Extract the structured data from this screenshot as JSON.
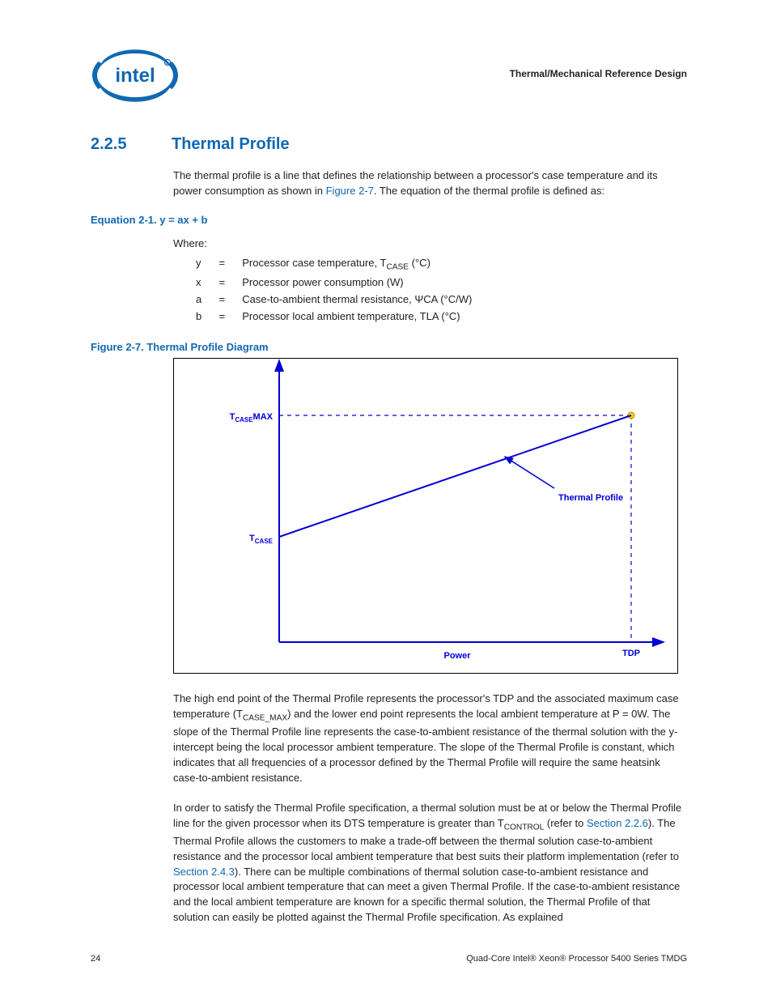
{
  "header": {
    "doc_section": "Thermal/Mechanical Reference Design"
  },
  "section": {
    "number": "2.2.5",
    "title": "Thermal Profile"
  },
  "intro_pre": "The thermal profile is a line that defines the relationship between a processor's case temperature and its power consumption as shown in ",
  "intro_link": "Figure 2-7",
  "intro_post": ". The equation of the thermal profile is defined as:",
  "equation": {
    "label": "Equation 2-1. y = ax + b"
  },
  "where_label": "Where:",
  "vars": {
    "y": {
      "sym": "y",
      "eq": "=",
      "desc_pre": "Processor case temperature, T",
      "desc_sub": "CASE",
      "desc_post": " (°C)"
    },
    "x": {
      "sym": "x",
      "eq": "=",
      "desc": "Processor power consumption (W)"
    },
    "a": {
      "sym": "a",
      "eq": "=",
      "desc": "Case-to-ambient thermal resistance, ΨCA (°C/W)"
    },
    "b": {
      "sym": "b",
      "eq": "=",
      "desc": "Processor local ambient temperature, TLA (°C)"
    }
  },
  "figure": {
    "label": "Figure 2-7.  Thermal Profile Diagram",
    "y_max_label_pre": "T",
    "y_max_label_sub": "CASE",
    "y_max_label_post": "MAX",
    "y_low_label_pre": "T",
    "y_low_label_sub": "CASE",
    "line_label": "Thermal Profile",
    "x_tdp_label": "TDP",
    "x_axis_label": "Power"
  },
  "para2_a": "The high end point of the Thermal Profile represents the processor's TDP and the associated maximum case temperature (T",
  "para2_sub": "CASE_MAX",
  "para2_b": ") and the lower end point represents the local ambient temperature at P = 0W. The slope of the Thermal Profile line represents the case-to-ambient resistance of the thermal solution with the y-intercept being the local processor ambient temperature. The slope of the Thermal Profile is constant, which indicates that all frequencies of a processor defined by the Thermal Profile will require the same heatsink case-to-ambient resistance.",
  "para3_a": "In order to satisfy the Thermal Profile specification, a thermal solution must be at or below the Thermal Profile line for the given processor when its DTS temperature is greater than T",
  "para3_sub": "CONTROL",
  "para3_b": " (refer to ",
  "para3_link1": "Section 2.2.6",
  "para3_c": "). The Thermal Profile allows the customers to make a trade-off between the thermal solution case-to-ambient resistance and the processor local ambient temperature that best suits their platform implementation (refer to ",
  "para3_link2": "Section 2.4.3",
  "para3_d": "). There can be multiple combinations of thermal solution case-to-ambient resistance and processor local ambient temperature that can meet a given Thermal Profile. If the case-to-ambient resistance and the local ambient temperature are known for a specific thermal solution, the Thermal Profile of that solution can easily be plotted against the Thermal Profile specification. As explained",
  "footer": {
    "page": "24",
    "doc": "Quad-Core Intel® Xeon® Processor 5400 Series TMDG"
  },
  "chart_data": {
    "type": "line",
    "title": "Thermal Profile Diagram",
    "xlabel": "Power",
    "ylabel": "T_CASE",
    "series": [
      {
        "name": "Thermal Profile",
        "points": [
          {
            "x_label": "0",
            "y_label": "T_CASE (ambient, b)"
          },
          {
            "x_label": "TDP",
            "y_label": "T_CASE_MAX"
          }
        ]
      }
    ],
    "annotations": [
      "T_CASE MAX",
      "T_CASE",
      "TDP",
      "Thermal Profile"
    ],
    "equation": "y = a*x + b"
  }
}
